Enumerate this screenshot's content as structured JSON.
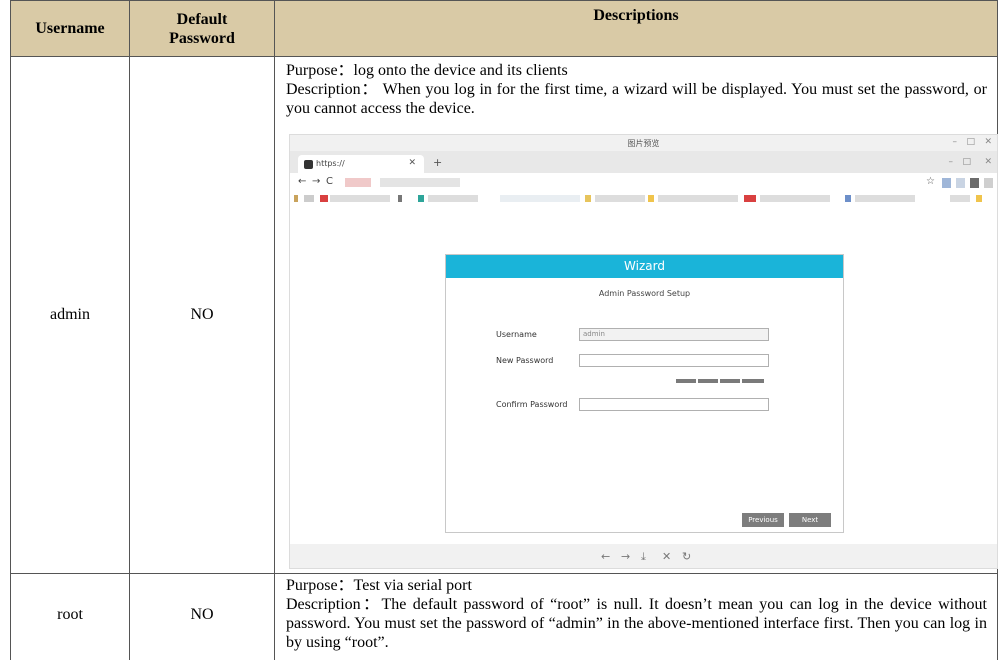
{
  "table": {
    "headers": {
      "username": "Username",
      "default_password_line1": "Default",
      "default_password_line2": "Password",
      "descriptions": "Descriptions"
    },
    "rows": [
      {
        "username": "admin",
        "default_password": "NO",
        "purpose": "Purpose：log onto the device and its clients",
        "description": "Description： When you log in for the first time, a wizard will be displayed. You must set the password, or you cannot access the device."
      },
      {
        "username": "root",
        "default_password": "NO",
        "purpose": "Purpose：Test via serial port",
        "description": "Description：The default password of “root” is null. It doesn’t mean you can log in the device without password. You must set the password of “admin” in the above-mentioned interface first. Then you can log in by using “root”."
      }
    ]
  },
  "screenshot": {
    "viewer_title": "图片预览",
    "tab_label": "https://",
    "wizard": {
      "title": "Wizard",
      "subtitle": "Admin Password Setup",
      "username_label": "Username",
      "username_value": "admin",
      "new_password_label": "New Password",
      "confirm_password_label": "Confirm Password",
      "previous_button": "Previous",
      "next_button": "Next"
    },
    "colors": {
      "wizard_header": "#1ab4d9",
      "table_header": "#d9caa6"
    }
  }
}
